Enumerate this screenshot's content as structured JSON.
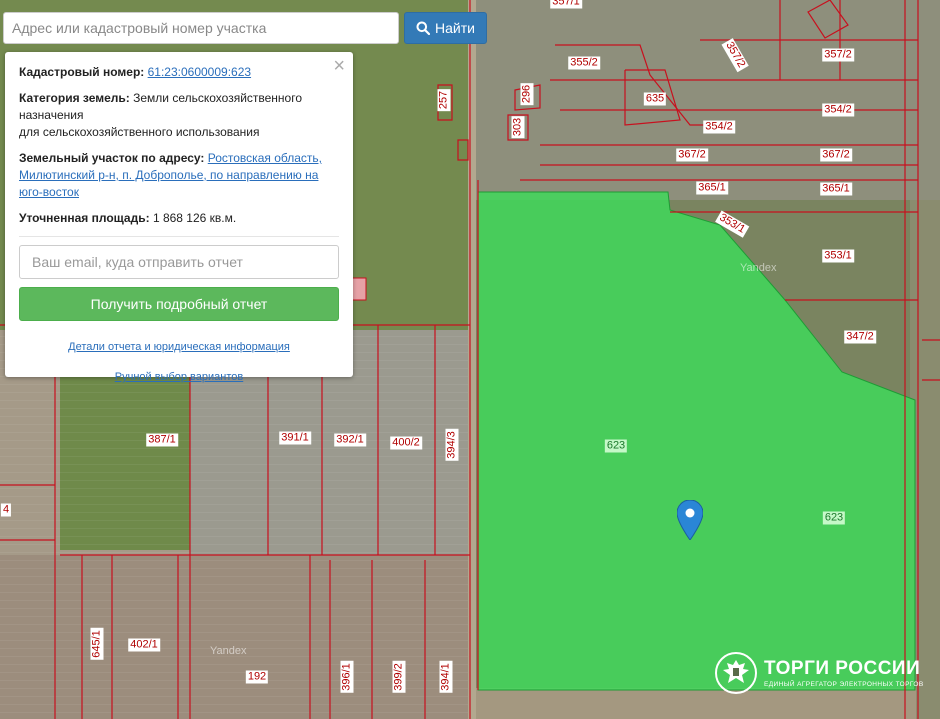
{
  "search": {
    "placeholder": "Адрес или кадастровый номер участка",
    "button_label": "Найти"
  },
  "info_panel": {
    "cadastral_label": "Кадастровый номер:",
    "cadastral_value": "61:23:0600009:623",
    "category_label": "Категория земель:",
    "category_value_1": "Земли сельскохозяйственного назначения",
    "category_value_2": "для сельскохозяйственного использования",
    "address_label": "Земельный участок по адресу:",
    "address_value": "Ростовская область, Милютинский р-н, п. Доброполье, по направлению на юго-восток",
    "area_label": "Уточненная площадь:",
    "area_value": "1 868 126 кв.м.",
    "email_placeholder": "Ваш email, куда отправить отчет",
    "report_button": "Получить подробный отчет",
    "details_link": "Детали отчета и юридическая информация",
    "manual_link": "Ручной выбор вариантов",
    "close_symbol": "×"
  },
  "map": {
    "watermark": "Yandex",
    "highlight_color": "#3ddc5a",
    "boundary_color": "#c8101e",
    "parcel_labels": [
      "357/1",
      "355/2",
      "357/2",
      "357/2",
      "354/2",
      "354/2",
      "635",
      "367/2",
      "367/2",
      "365/1",
      "365/1",
      "353/1",
      "353/1",
      "347/2",
      "296",
      "303",
      "257",
      "387/1",
      "391/1",
      "392/1",
      "400/2",
      "394/3",
      "623",
      "623",
      "645/1",
      "402/1",
      "192",
      "396/1",
      "399/2",
      "394/1",
      "4"
    ]
  },
  "brand": {
    "name": "ТОРГИ РОССИИ",
    "subtitle": "ЕДИНЫЙ АГРЕГАТОР ЭЛЕКТРОННЫХ ТОРГОВ"
  }
}
